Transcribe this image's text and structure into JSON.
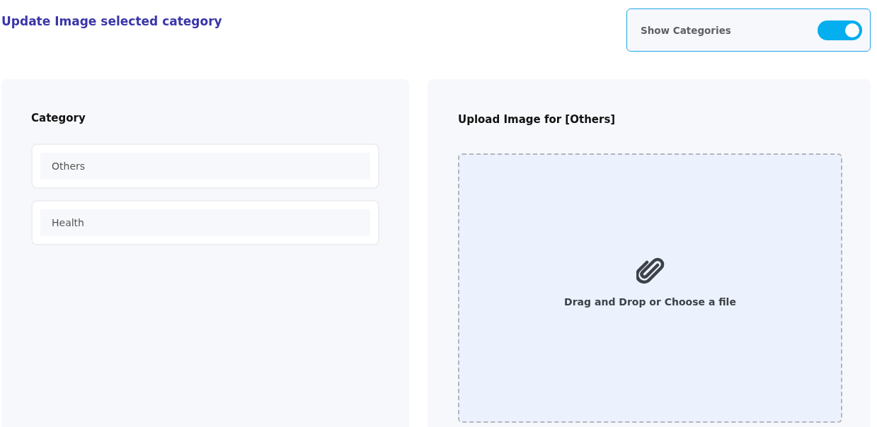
{
  "title": "Update Image selected category",
  "toggle": {
    "label": "Show Categories",
    "on": true
  },
  "category_panel": {
    "heading": "Category",
    "items": [
      {
        "label": "Others"
      },
      {
        "label": "Health"
      }
    ]
  },
  "upload_panel": {
    "heading": "Upload Image for [Others]",
    "dropzone_text": "Drag and Drop or Choose a file"
  }
}
